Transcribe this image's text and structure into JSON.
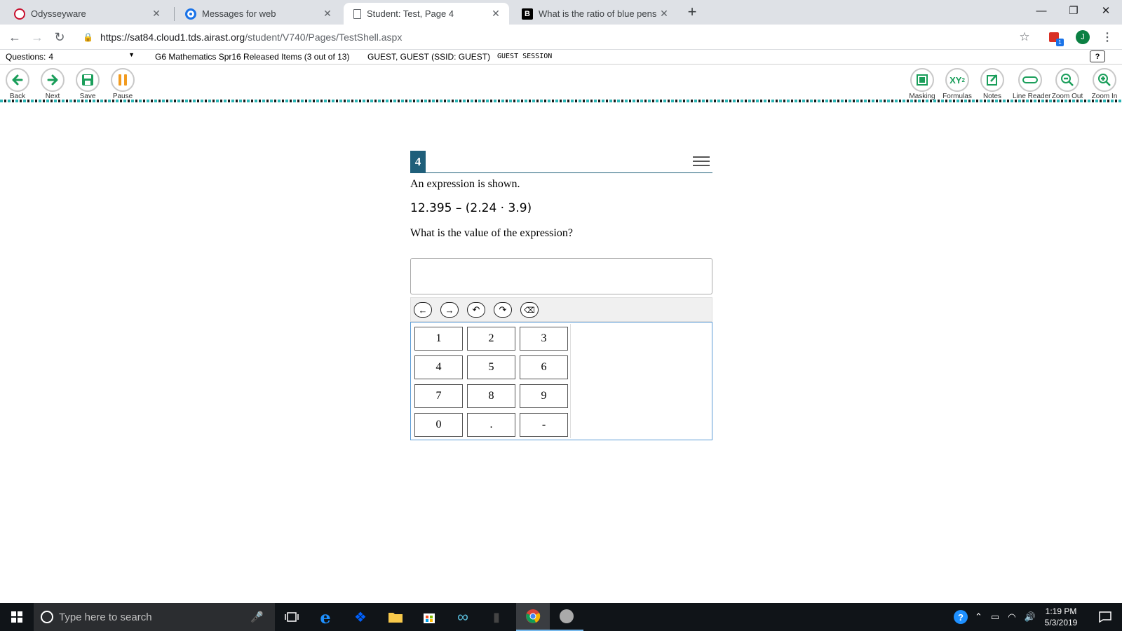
{
  "browser": {
    "tabs": [
      {
        "title": "Odysseyware",
        "icon": "odysseyware-favicon"
      },
      {
        "title": "Messages for web",
        "icon": "messages-favicon"
      },
      {
        "title": "Student: Test, Page 4",
        "icon": "page-favicon"
      },
      {
        "title": "What is the ratio of blue pens to",
        "icon": "brainly-favicon"
      }
    ],
    "url_host": "https://sat84.cloud1.tds.airast.org",
    "url_path": "/student/V740/Pages/TestShell.aspx",
    "profile_initial": "J",
    "extension_badge": "1"
  },
  "infobar": {
    "questions_label": "Questions:",
    "questions_value": "4",
    "test_name": "G6 Mathematics Spr16 Released Items (3 out of 13)",
    "student": "GUEST, GUEST (SSID: GUEST)",
    "session": "GUEST SESSION",
    "help": "?"
  },
  "tools_left": [
    {
      "label": "Back"
    },
    {
      "label": "Next"
    },
    {
      "label": "Save"
    },
    {
      "label": "Pause"
    }
  ],
  "tools_right": [
    {
      "label": "Masking"
    },
    {
      "label": "Formulas"
    },
    {
      "label": "Notes"
    },
    {
      "label": "Line Reader"
    },
    {
      "label": "Zoom Out"
    },
    {
      "label": "Zoom In"
    }
  ],
  "formulas_icon_text": "XY",
  "formulas_icon_sup": "2",
  "question": {
    "number": "4",
    "line1": "An expression is shown.",
    "expression": "12.395 – (2.24 · 3.9)",
    "line2": "What is the value of the expression?",
    "answer_value": ""
  },
  "keypad": {
    "keys": [
      "1",
      "2",
      "3",
      "4",
      "5",
      "6",
      "7",
      "8",
      "9",
      "0",
      ".",
      "-"
    ]
  },
  "taskbar": {
    "search_placeholder": "Type here to search",
    "time": "1:19 PM",
    "date": "5/3/2019"
  }
}
